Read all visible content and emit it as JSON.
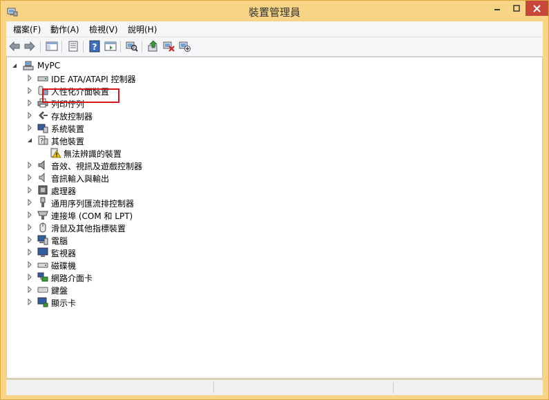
{
  "window": {
    "title": "裝置管理員",
    "accent": "#f8d487"
  },
  "menu": [
    {
      "label": "檔案(F)"
    },
    {
      "label": "動作(A)"
    },
    {
      "label": "檢視(V)"
    },
    {
      "label": "說明(H)"
    }
  ],
  "toolbar": {
    "buttons": [
      {
        "icon": "back-arrow-icon"
      },
      {
        "icon": "forward-arrow-icon"
      },
      {
        "icon": "show-hide-console-tree-icon"
      },
      {
        "icon": "properties-icon"
      },
      {
        "icon": "help-icon"
      },
      {
        "icon": "action-pane-icon"
      },
      {
        "icon": "scan-hardware-icon"
      },
      {
        "icon": "update-driver-icon"
      },
      {
        "icon": "uninstall-device-icon"
      },
      {
        "icon": "add-legacy-hardware-icon"
      }
    ]
  },
  "tree": {
    "root": {
      "label": "MyPC",
      "icon": "computer-icon",
      "expanded": true
    },
    "categories": [
      {
        "label": "IDE ATA/ATAPI 控制器",
        "icon": "ide-controller-icon",
        "expanded": false
      },
      {
        "label": "人性化介面裝置",
        "icon": "hid-icon",
        "expanded": false
      },
      {
        "label": "列印佇列",
        "icon": "printer-icon",
        "expanded": false
      },
      {
        "label": "存放控制器",
        "icon": "storage-controller-icon",
        "expanded": false
      },
      {
        "label": "系統裝置",
        "icon": "system-device-icon",
        "expanded": false
      },
      {
        "label": "其他裝置",
        "icon": "other-devices-icon",
        "expanded": true,
        "children": [
          {
            "label": "無法辨識的裝置",
            "icon": "unknown-device-warning-icon",
            "selected": true
          }
        ]
      },
      {
        "label": "音效、視訊及遊戲控制器",
        "icon": "sound-icon",
        "expanded": false
      },
      {
        "label": "音訊輸入與輸出",
        "icon": "audio-io-icon",
        "expanded": false
      },
      {
        "label": "處理器",
        "icon": "processor-icon",
        "expanded": false
      },
      {
        "label": "通用序列匯流排控制器",
        "icon": "usb-icon",
        "expanded": false
      },
      {
        "label": "連接埠 (COM 和 LPT)",
        "icon": "port-icon",
        "expanded": false
      },
      {
        "label": "滑鼠及其他指標裝置",
        "icon": "mouse-icon",
        "expanded": false
      },
      {
        "label": "電腦",
        "icon": "computer-category-icon",
        "expanded": false
      },
      {
        "label": "監視器",
        "icon": "monitor-icon",
        "expanded": false
      },
      {
        "label": "磁碟機",
        "icon": "disk-drive-icon",
        "expanded": false
      },
      {
        "label": "網路介面卡",
        "icon": "network-adapter-icon",
        "expanded": false
      },
      {
        "label": "鍵盤",
        "icon": "keyboard-icon",
        "expanded": false
      },
      {
        "label": "顯示卡",
        "icon": "display-adapter-icon",
        "expanded": false
      }
    ]
  },
  "colors": {
    "highlight_border": "#d6141a",
    "close_button": "#c7473a"
  }
}
